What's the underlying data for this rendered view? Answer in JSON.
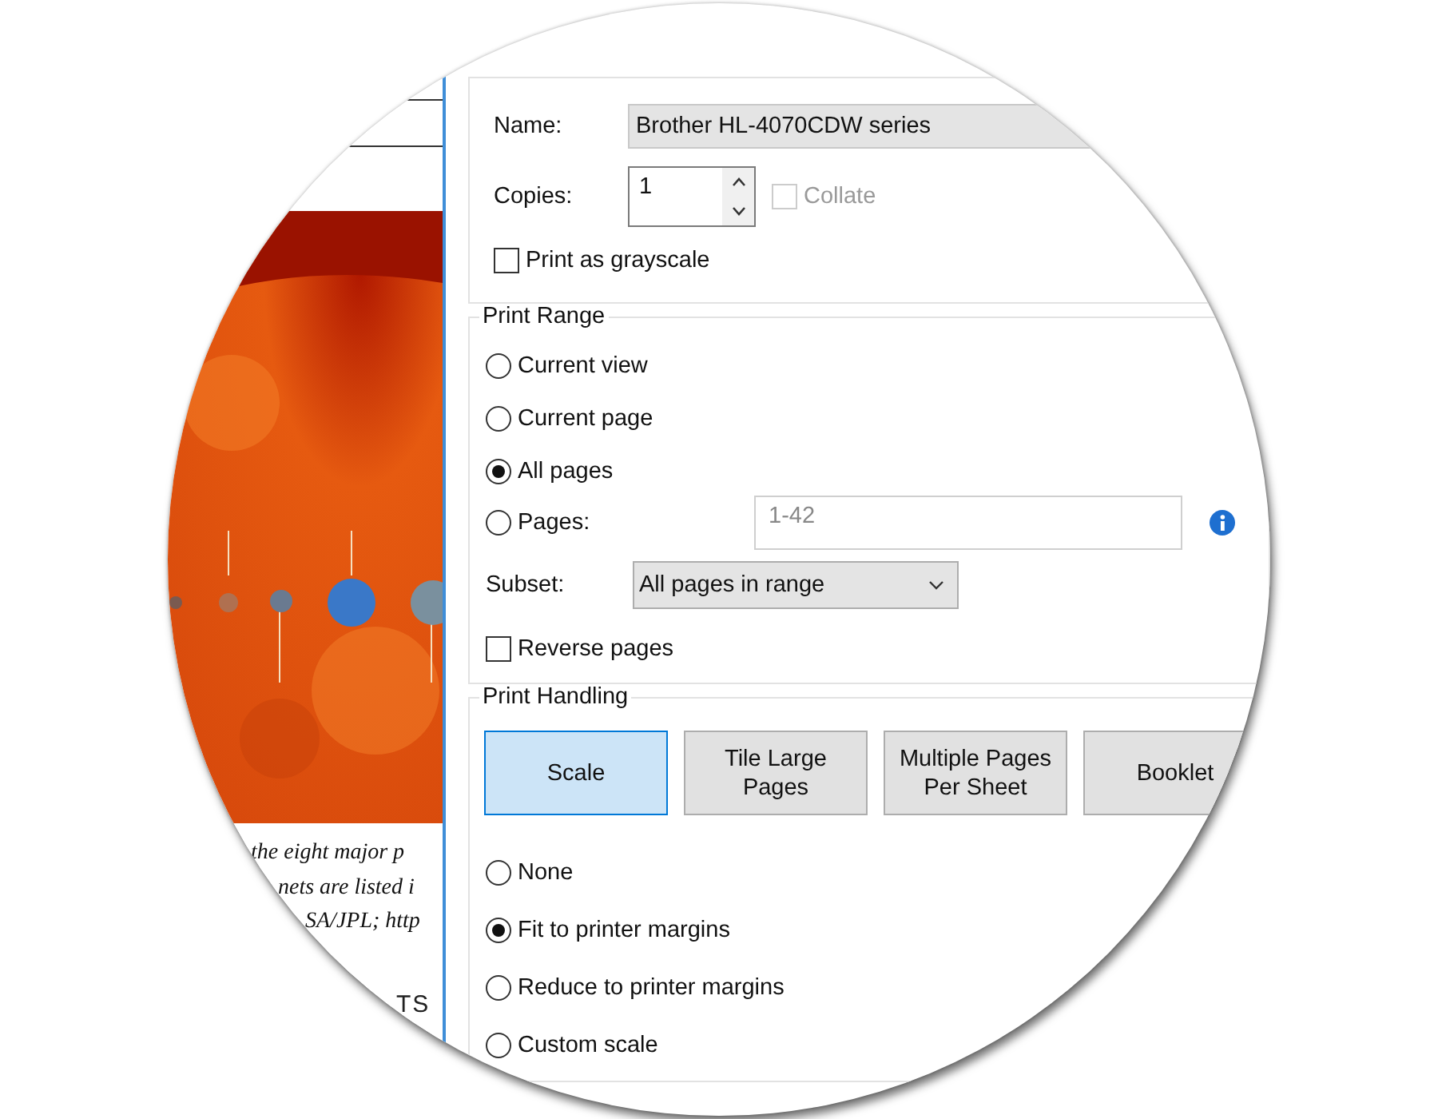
{
  "document": {
    "picture": {
      "kind": "picture"
    },
    "caption_lines": [
      "the eight major p",
      "nets are listed i",
      "SA/JPL; http"
    ],
    "heading_fragment": "TS"
  },
  "printer": {
    "name_label": "Name:",
    "name_value": "Brother HL-4070CDW series",
    "copies_label": "Copies:",
    "copies_value": "1",
    "collate": {
      "label": "Collate",
      "checked": false,
      "disabled": true
    },
    "grayscale": {
      "label": "Print as grayscale",
      "checked": false
    }
  },
  "print_range": {
    "title": "Print Range",
    "options": [
      {
        "label": "Current view",
        "selected": false
      },
      {
        "label": "Current page",
        "selected": false
      },
      {
        "label": "All pages",
        "selected": true
      },
      {
        "label": "Pages:",
        "selected": false,
        "field": {
          "value": "1-42",
          "disabled": true
        }
      }
    ],
    "subset_label": "Subset:",
    "subset_value": "All pages in range",
    "reverse": {
      "label": "Reverse pages",
      "checked": false
    }
  },
  "print_handling": {
    "title": "Print Handling",
    "modes": [
      {
        "label": "Scale",
        "selected": true
      },
      {
        "label": "Tile Large Pages",
        "selected": false
      },
      {
        "label": "Multiple Pages Per Sheet",
        "selected": false
      },
      {
        "label": "Booklet",
        "selected": false
      }
    ],
    "scale_options": [
      {
        "label": "None",
        "selected": false
      },
      {
        "label": "Fit to printer margins",
        "selected": true
      },
      {
        "label": "Reduce to printer margins",
        "selected": false
      },
      {
        "label": "Custom scale",
        "selected": false
      }
    ]
  }
}
